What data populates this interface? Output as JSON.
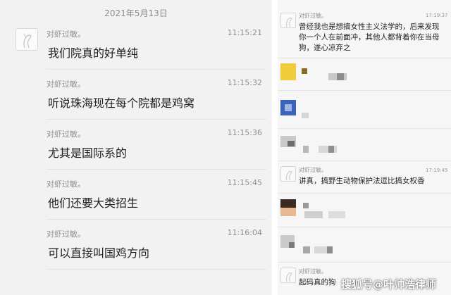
{
  "left_panel": {
    "date": "2021年5月13日",
    "messages": [
      {
        "sender": "对虾过敏。",
        "time": "11:15:21",
        "text": "我们院真的好单纯"
      },
      {
        "sender": "对虾过敏。",
        "time": "11:15:32",
        "text": "听说珠海现在每个院都是鸡窝"
      },
      {
        "sender": "对虾过敏。",
        "time": "11:15:36",
        "text": "尤其是国际系的"
      },
      {
        "sender": "对虾过敏。",
        "time": "11:15:45",
        "text": "他们还要大类招生"
      },
      {
        "sender": "对虾过敏。",
        "time": "11:16:04",
        "text": "可以直接叫国鸡方向"
      }
    ]
  },
  "right_panel": {
    "msg1": {
      "sender": "对虾过敏。",
      "time": "17:19:37",
      "text": "曾经我也是想搞女性主义法学的，后来发现你一个人在前面冲，其他人都背着你在当母狗，遂心凉弃之"
    },
    "msg2": {
      "sender": "对虾过敏。",
      "time": "17:19:45",
      "text": "讲真，搞野生动物保护法逗比搞女权香"
    },
    "msg3": {
      "sender": "对虾过敏。",
      "text": "起码真的狗"
    }
  },
  "watermark": "搜狐号@叶帅浩律师",
  "colors": {
    "left_bg": "#f2f2f2",
    "right_bg": "#f6f6f6",
    "text": "#1e1e1e",
    "meta": "#8e8e8e"
  }
}
